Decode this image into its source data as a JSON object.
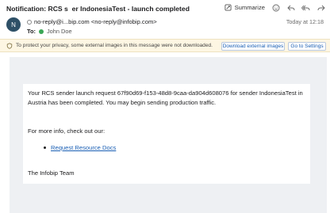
{
  "email": {
    "subject": "Notification: RCS s  er IndonesiaTest - launch completed",
    "sender_initial": "N",
    "from": "no-reply@i...bip.com <no-reply@infobip.com>",
    "to_label": "To:",
    "to_name": "John Doe",
    "timestamp": "Today at 12:18"
  },
  "toolbar": {
    "summarize_label": "Summarize",
    "icons": [
      "summarize-icon",
      "emoji-icon",
      "reply-icon",
      "reply-all-icon",
      "forward-icon"
    ]
  },
  "privacy_bar": {
    "text": "To protect your privacy, some external images in this message were not downloaded.",
    "download_button": "Download external images",
    "settings_button": "Go to Settings"
  },
  "message": {
    "paragraph1": "Your RCS sender launch request 67f90d69-f153-48d8-9caa-da904d608076 for sender IndonesiaTest in Austria has been completed. You may begin sending production traffic.",
    "paragraph2": "For more info, check out our:",
    "link_text": "Request Resource Docs",
    "signature": "The Infobip Team"
  },
  "colors": {
    "avatar_bg": "#2e5067",
    "privacy_bg": "#fdf6e3",
    "message_bg": "#eef0f3",
    "link": "#1a5fb4",
    "online": "#3aa655"
  }
}
